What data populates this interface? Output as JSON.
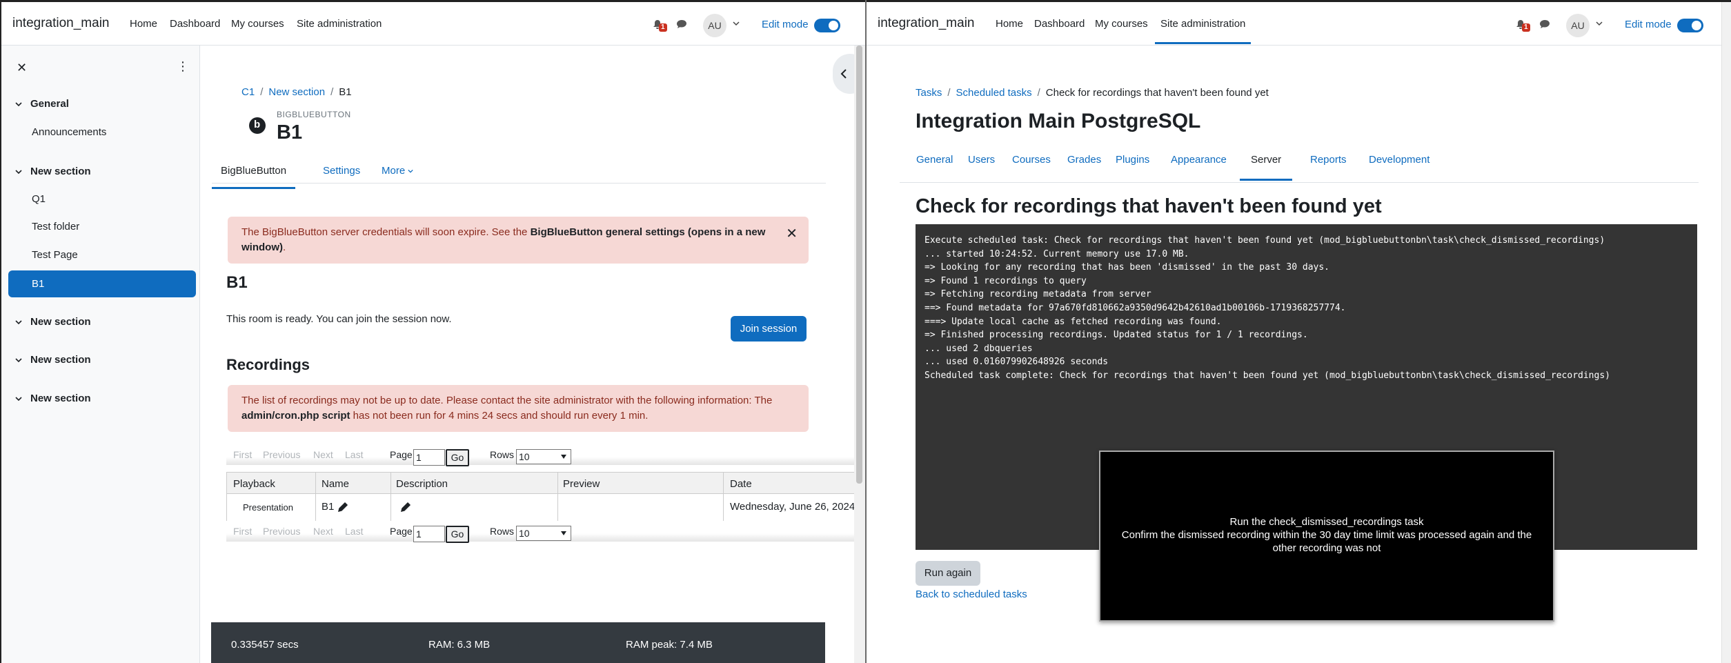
{
  "left": {
    "navbar": {
      "brand": "integration_main",
      "links": [
        "Home",
        "Dashboard",
        "My courses",
        "Site administration"
      ],
      "notification_count": "1",
      "avatar_initials": "AU",
      "edit_mode_label": "Edit mode"
    },
    "drawer": {
      "close_icon": "✕",
      "menu_icon": "⋮",
      "sections": [
        {
          "title": "General",
          "items": [
            "Announcements"
          ]
        },
        {
          "title": "New section",
          "items": [
            "Q1",
            "Test folder",
            "Test Page",
            "B1"
          ]
        },
        {
          "title": "New section",
          "items": []
        },
        {
          "title": "New section",
          "items": []
        },
        {
          "title": "New section",
          "items": []
        }
      ],
      "active_item": "B1"
    },
    "breadcrumb": [
      "C1",
      "New section",
      "B1"
    ],
    "module": {
      "type": "BIGBLUEBUTTON",
      "title": "B1"
    },
    "tabs": [
      "BigBlueButton",
      "Settings",
      "More"
    ],
    "alert_credentials": {
      "text_before": "The BigBlueButton server credentials will soon expire. See the ",
      "bold": "BigBlueButton general settings (opens in a new window)",
      "text_after": "."
    },
    "room": {
      "heading": "B1",
      "status": "This room is ready. You can join the session now.",
      "join_label": "Join session"
    },
    "recordings": {
      "heading": "Recordings",
      "alert": {
        "text_before": "The list of recordings may not be up to date. Please contact the site administrator with the following information: The ",
        "bold": "admin/cron.php script",
        "text_after": " has not been run for 4 mins 24 secs and should run every 1 min."
      },
      "pager": {
        "first": "First",
        "previous": "Previous",
        "next": "Next",
        "last": "Last",
        "page_label": "Page",
        "page_value": "1",
        "go": "Go",
        "rows_label": "Rows",
        "rows_value": "10"
      },
      "columns": [
        "Playback",
        "Name",
        "Description",
        "Preview",
        "Date"
      ],
      "rows": [
        {
          "playback": "Presentation",
          "name": "B1",
          "description": "",
          "preview": "",
          "date": "Wednesday, June 26, 2024"
        }
      ]
    },
    "footer": {
      "time": "0.335457 secs",
      "ram": "RAM: 6.3 MB",
      "ram_peak": "RAM peak: 7.4 MB"
    }
  },
  "right": {
    "navbar": {
      "brand": "integration_main",
      "links": [
        "Home",
        "Dashboard",
        "My courses",
        "Site administration"
      ],
      "notification_count": "1",
      "avatar_initials": "AU",
      "edit_mode_label": "Edit mode"
    },
    "breadcrumb": [
      "Tasks",
      "Scheduled tasks",
      "Check for recordings that haven't been found yet"
    ],
    "site_title": "Integration Main PostgreSQL",
    "tabs": [
      "General",
      "Users",
      "Courses",
      "Grades",
      "Plugins",
      "Appearance",
      "Server",
      "Reports",
      "Development"
    ],
    "active_tab": "Server",
    "task_title": "Check for recordings that haven't been found yet",
    "console_lines": [
      "Execute scheduled task: Check for recordings that haven't been found yet (mod_bigbluebuttonbn\\task\\check_dismissed_recordings)",
      "... started 10:24:52. Current memory use 17.0 MB.",
      "=> Looking for any recording that has been 'dismissed' in the past 30 days.",
      "=> Found 1 recordings to query",
      "=> Fetching recording metadata from server",
      "==> Found metadata for 97a670fd810662a9350d9642b42610ad1b00106b-1719368257774.",
      "===> Update local cache as fetched recording was found.",
      "=> Finished processing recordings. Updated status for 1 / 1 recordings.",
      "... used 2 dbqueries",
      "... used 0.016079902648926 seconds",
      "Scheduled task complete: Check for recordings that haven't been found yet (mod_bigbluebuttonbn\\task\\check_dismissed_recordings)"
    ],
    "run_again_label": "Run again",
    "back_link": "Back to scheduled tasks",
    "overlay": {
      "line1": "Run the check_dismissed_recordings task",
      "line2": "Confirm the dismissed recording within the 30 day time limit was processed again and the other recording was not"
    }
  },
  "colors": {
    "primary": "#0f6cbf",
    "alert_bg": "#f6d8d5",
    "console_bg": "#343434",
    "footer_bg": "#343a40"
  }
}
